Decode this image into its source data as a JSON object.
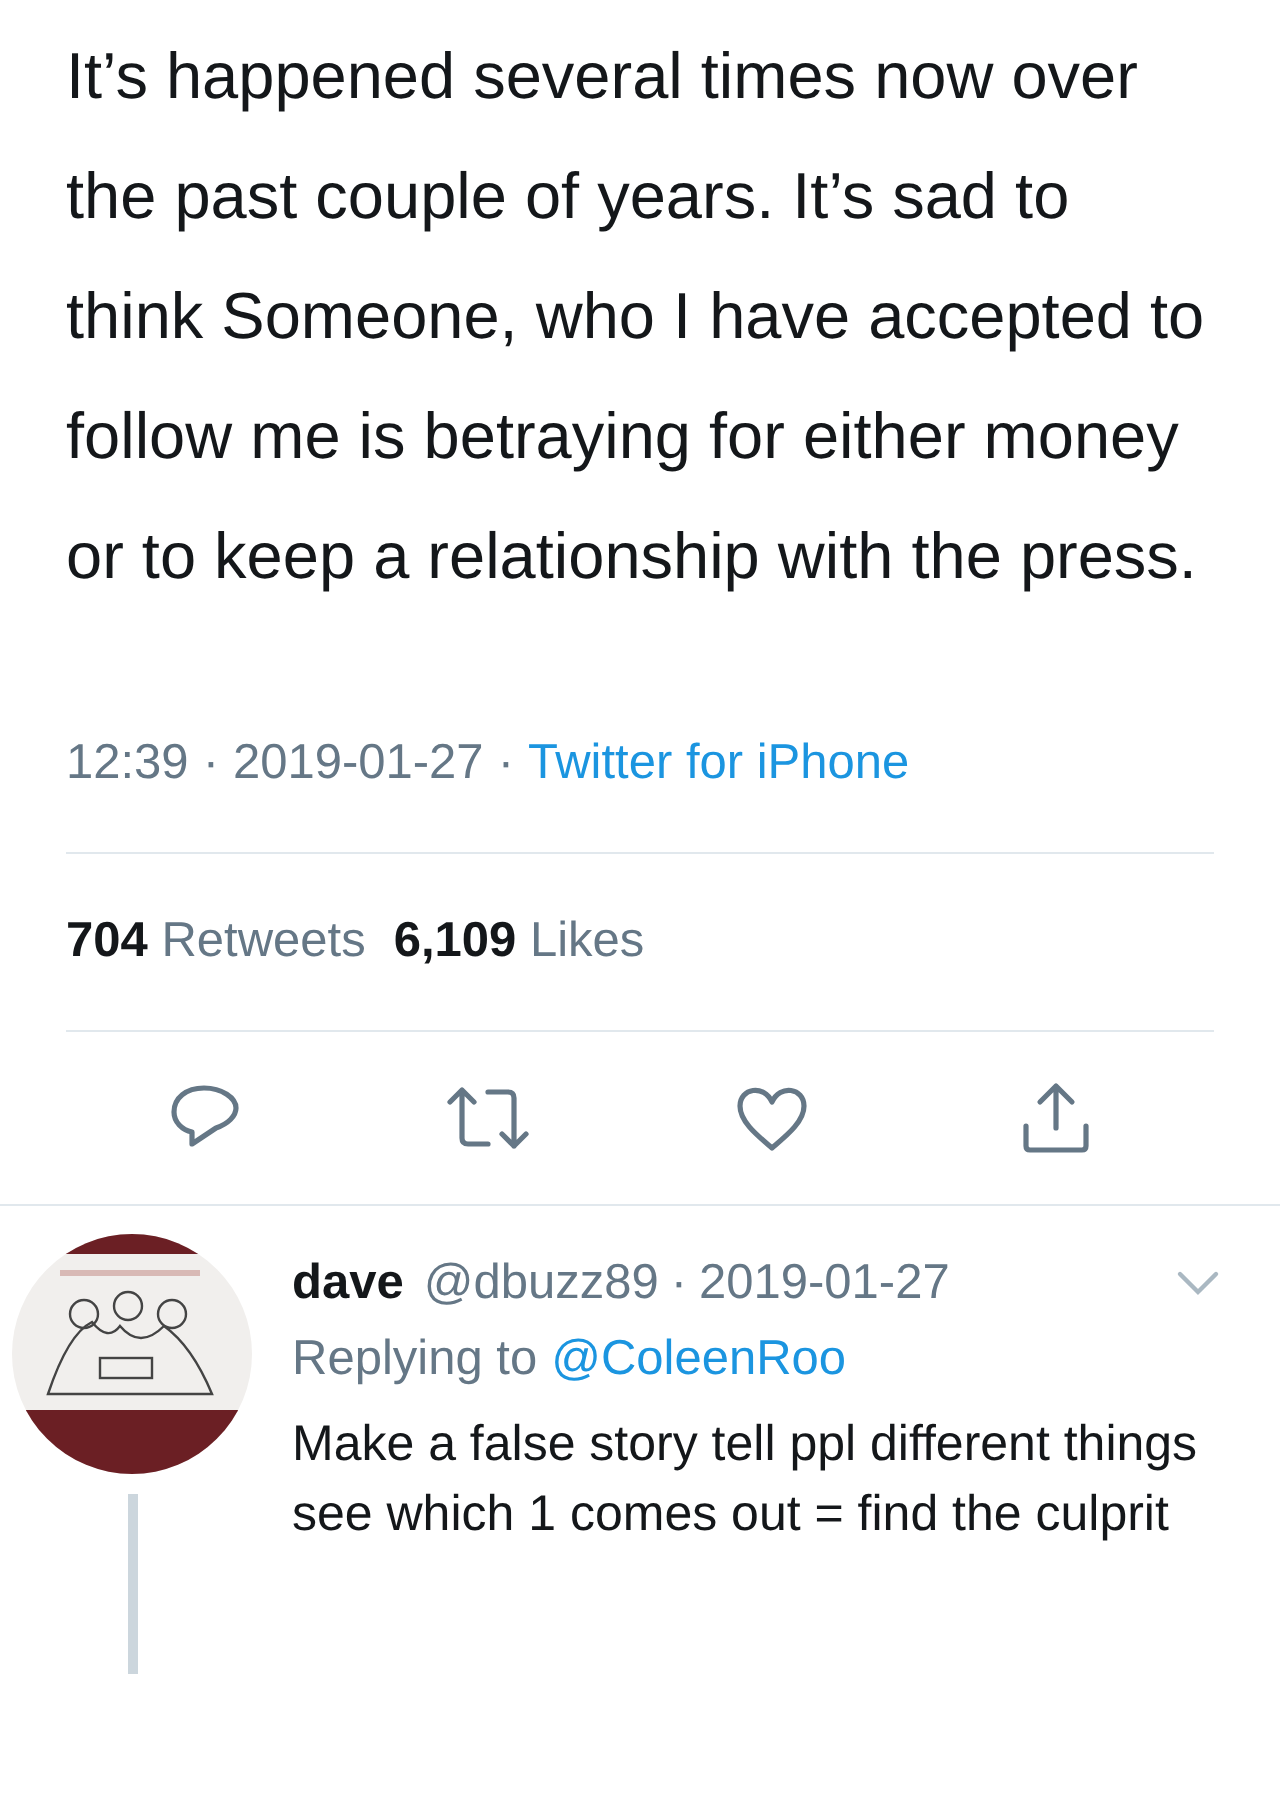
{
  "tweet": {
    "text": "It’s happened several times now over the past couple of years. It’s sad to think Someone, who I have accepted to follow me is betraying for either money or to keep a relationship with the press.",
    "meta": [
      {
        "kind": "text",
        "text": "12:39"
      },
      {
        "kind": "dot",
        "text": "·"
      },
      {
        "kind": "text",
        "text": "2019-01-27"
      },
      {
        "kind": "dot",
        "text": "·"
      },
      {
        "kind": "link",
        "text": "Twitter for iPhone"
      }
    ],
    "stats": [
      {
        "count": "704",
        "label": "Retweets"
      },
      {
        "count": "6,109",
        "label": "Likes"
      }
    ],
    "actions": [
      {
        "kind": "reply"
      },
      {
        "kind": "retweet"
      },
      {
        "kind": "like"
      },
      {
        "kind": "share"
      }
    ]
  },
  "reply": {
    "name": "dave",
    "handle": "@dbuzz89",
    "separator": "·",
    "date": "2019-01-27",
    "replying_label": "Replying to",
    "replying_to": "@ColeenRoo",
    "text": "Make a false story tell ppl different things see which 1 comes out = find the culprit"
  }
}
